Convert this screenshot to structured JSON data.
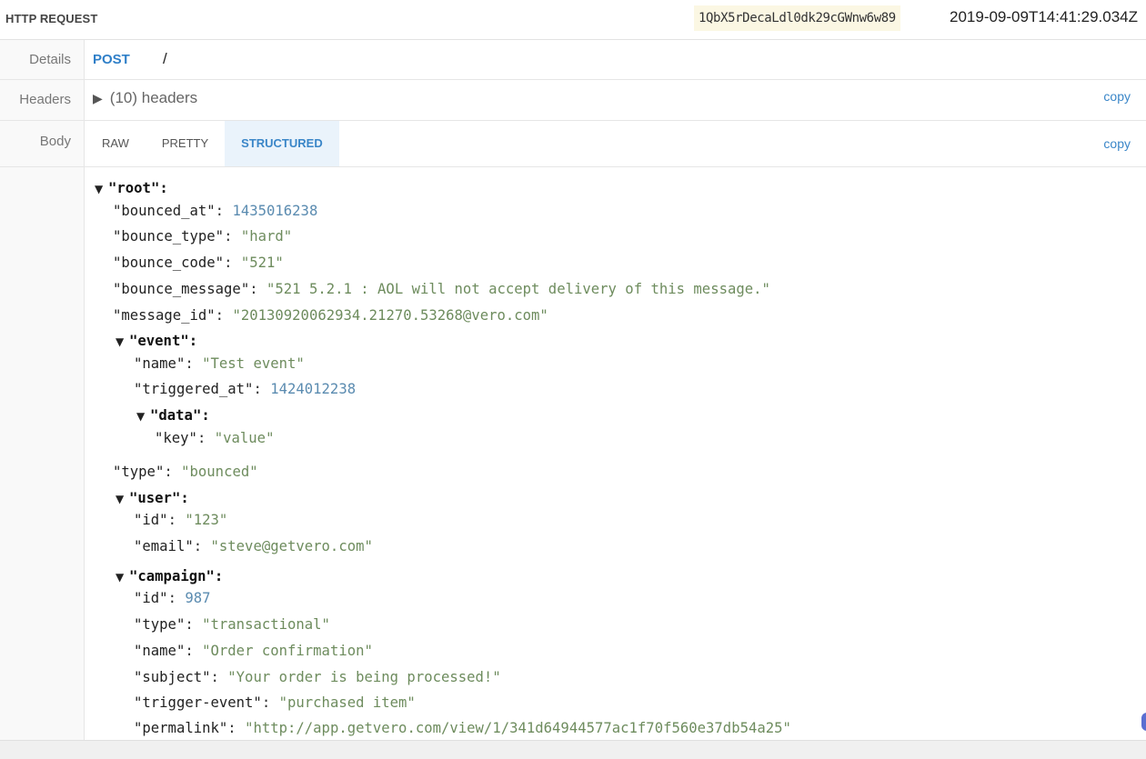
{
  "header": {
    "title": "HTTP REQUEST",
    "request_id": "1QbX5rDecaLdl0dk29cGWnw6w89",
    "timestamp": "2019-09-09T14:41:29.034Z"
  },
  "details": {
    "label": "Details",
    "method": "POST",
    "path": "/"
  },
  "headers_row": {
    "label": "Headers",
    "summary": "(10) headers",
    "copy_label": "copy"
  },
  "body_row": {
    "label": "Body",
    "tabs": [
      {
        "label": "RAW"
      },
      {
        "label": "PRETTY"
      },
      {
        "label": "STRUCTURED"
      }
    ],
    "active_tab": "STRUCTURED",
    "copy_label": "copy"
  },
  "tree": {
    "root": "\"root\"",
    "bounced_at": {
      "k": "\"bounced_at\"",
      "v": "1435016238"
    },
    "bounce_type": {
      "k": "\"bounce_type\"",
      "v": "\"hard\""
    },
    "bounce_code": {
      "k": "\"bounce_code\"",
      "v": "\"521\""
    },
    "bounce_message": {
      "k": "\"bounce_message\"",
      "v": "\"521 5.2.1 : AOL will not accept delivery of this message.\""
    },
    "message_id": {
      "k": "\"message_id\"",
      "v": "\"20130920062934.21270.53268@vero.com\""
    },
    "event": "\"event\"",
    "event_name": {
      "k": "\"name\"",
      "v": "\"Test event\""
    },
    "event_triggered_at": {
      "k": "\"triggered_at\"",
      "v": "1424012238"
    },
    "event_data": "\"data\"",
    "data_key": {
      "k": "\"key\"",
      "v": "\"value\""
    },
    "type": {
      "k": "\"type\"",
      "v": "\"bounced\""
    },
    "user": "\"user\"",
    "user_id": {
      "k": "\"id\"",
      "v": "\"123\""
    },
    "user_email": {
      "k": "\"email\"",
      "v": "\"steve@getvero.com\""
    },
    "campaign": "\"campaign\"",
    "campaign_id": {
      "k": "\"id\"",
      "v": "987"
    },
    "campaign_type": {
      "k": "\"type\"",
      "v": "\"transactional\""
    },
    "campaign_name": {
      "k": "\"name\"",
      "v": "\"Order confirmation\""
    },
    "campaign_subject": {
      "k": "\"subject\"",
      "v": "\"Your order is being processed!\""
    },
    "campaign_trigger": {
      "k": "\"trigger-event\"",
      "v": "\"purchased item\""
    },
    "campaign_permalink": {
      "k": "\"permalink\"",
      "v": "\"http://app.getvero.com/view/1/341d64944577ac1f70f560e37db54a25\""
    }
  },
  "icons": {
    "expand": "triangle-right-icon",
    "collapse": "triangle-down-icon"
  },
  "colors": {
    "accent": "#3a86c8",
    "string": "#6e8c5e",
    "number": "#5a8bb0",
    "id_bg": "#fbf7e3"
  }
}
